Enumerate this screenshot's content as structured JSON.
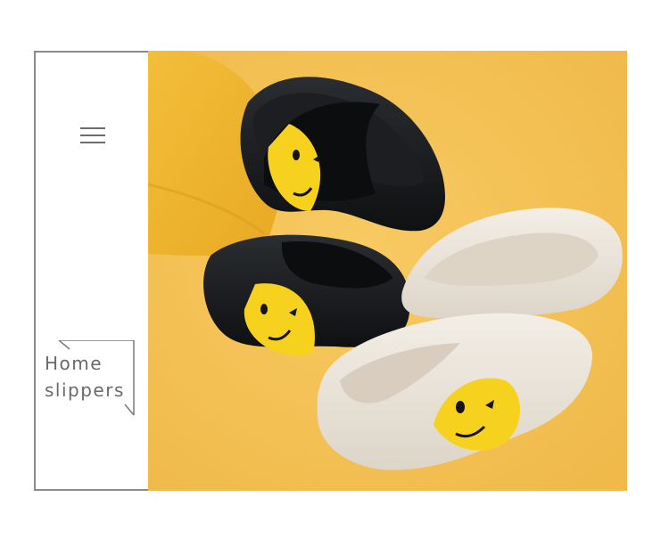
{
  "caption": {
    "line1": "Home",
    "line2": "slippers"
  },
  "icons": {
    "menu": "hamburger-menu-icon",
    "corner": "bracket-corner-icon"
  },
  "colors": {
    "background_yellow": "#f5c254",
    "pillow_yellow": "#f0b731",
    "slipper_black": "#151719",
    "slipper_cream": "#ece6dc",
    "smiley_yellow": "#f6d21f",
    "text_gray": "#6a6a6a"
  },
  "photo": {
    "subject": "product-photo"
  }
}
